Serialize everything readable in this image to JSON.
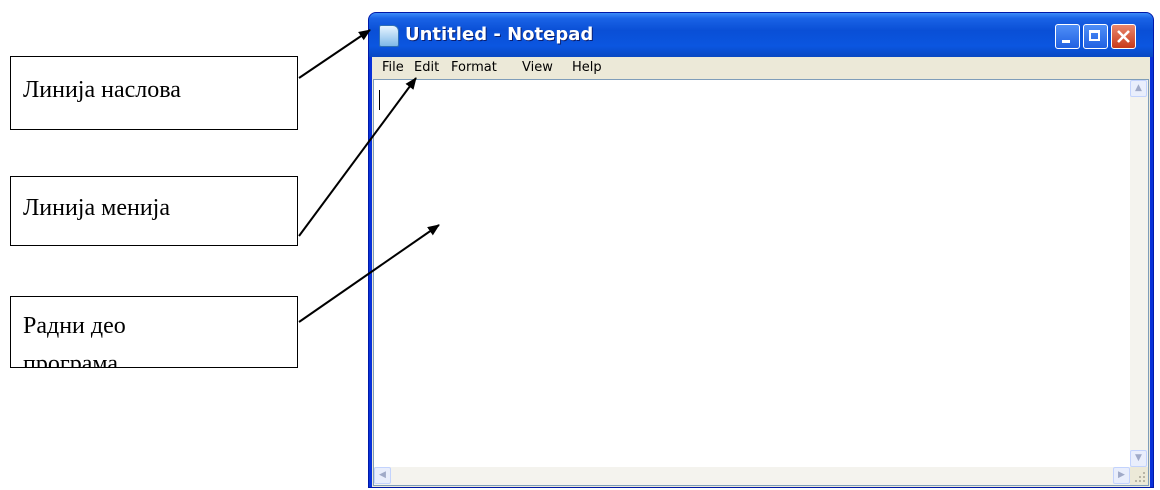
{
  "labels": {
    "title_bar": "Линија наслова",
    "menu_bar": "Линија менија",
    "work_area_line1": "Радни део",
    "work_area_line2": "програма"
  },
  "window": {
    "title": "Untitled - Notepad",
    "menu": [
      "File",
      "Edit",
      "Format",
      "View",
      "Help"
    ],
    "editor_text": ""
  },
  "colors": {
    "titlebar": "#0a4fd6",
    "close_button": "#c8391a",
    "menu_background": "#ece9d8"
  },
  "icons": [
    "notepad-icon",
    "minimize-icon",
    "maximize-icon",
    "close-icon",
    "scroll-up-icon",
    "scroll-down-icon",
    "scroll-left-icon",
    "scroll-right-icon",
    "resize-grip-icon"
  ]
}
